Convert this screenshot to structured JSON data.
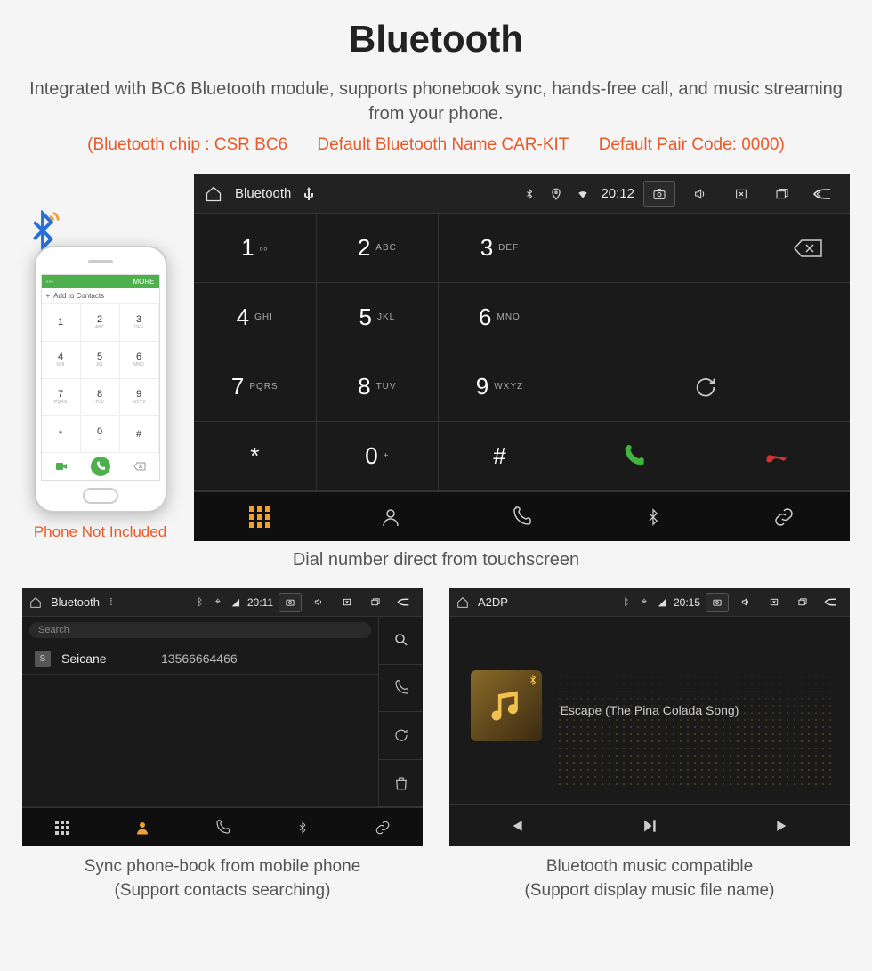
{
  "title": "Bluetooth",
  "subtitle": "Integrated with BC6 Bluetooth module, supports phonebook sync, hands-free call, and music streaming from your phone.",
  "spec": {
    "chip": "(Bluetooth chip : CSR BC6",
    "name": "Default Bluetooth Name CAR-KIT",
    "code": "Default Pair Code: 0000)"
  },
  "phone": {
    "top_more": "MORE",
    "add_label": "Add to Contacts",
    "keys": [
      {
        "n": "1",
        "s": ""
      },
      {
        "n": "2",
        "s": "ABC"
      },
      {
        "n": "3",
        "s": "DEF"
      },
      {
        "n": "4",
        "s": "GHI"
      },
      {
        "n": "5",
        "s": "JKL"
      },
      {
        "n": "6",
        "s": "MNO"
      },
      {
        "n": "7",
        "s": "PQRS"
      },
      {
        "n": "8",
        "s": "TUV"
      },
      {
        "n": "9",
        "s": "WXYZ"
      },
      {
        "n": "*",
        "s": ""
      },
      {
        "n": "0",
        "s": "+"
      },
      {
        "n": "#",
        "s": ""
      }
    ],
    "footnote": "Phone Not Included"
  },
  "dialer": {
    "status": {
      "app": "Bluetooth",
      "time": "20:12"
    },
    "keys": [
      {
        "n": "1",
        "s": "ₒₒ"
      },
      {
        "n": "2",
        "s": "ABC"
      },
      {
        "n": "3",
        "s": "DEF"
      },
      {
        "n": "4",
        "s": "GHI"
      },
      {
        "n": "5",
        "s": "JKL"
      },
      {
        "n": "6",
        "s": "MNO"
      },
      {
        "n": "7",
        "s": "PQRS"
      },
      {
        "n": "8",
        "s": "TUV"
      },
      {
        "n": "9",
        "s": "WXYZ"
      },
      {
        "n": "*",
        "s": ""
      },
      {
        "n": "0",
        "s": "+"
      },
      {
        "n": "#",
        "s": ""
      }
    ],
    "caption": "Dial number direct from touchscreen"
  },
  "contacts": {
    "status": {
      "app": "Bluetooth",
      "time": "20:11"
    },
    "search_placeholder": "Search",
    "rows": [
      {
        "badge": "S",
        "name": "Seicane",
        "number": "13566664466"
      }
    ],
    "caption": "Sync phone-book from mobile phone",
    "caption2": "(Support contacts searching)"
  },
  "music": {
    "status": {
      "app": "A2DP",
      "time": "20:15"
    },
    "track": "Escape (The Pina Colada Song)",
    "caption": "Bluetooth music compatible",
    "caption2": "(Support display music file name)"
  }
}
